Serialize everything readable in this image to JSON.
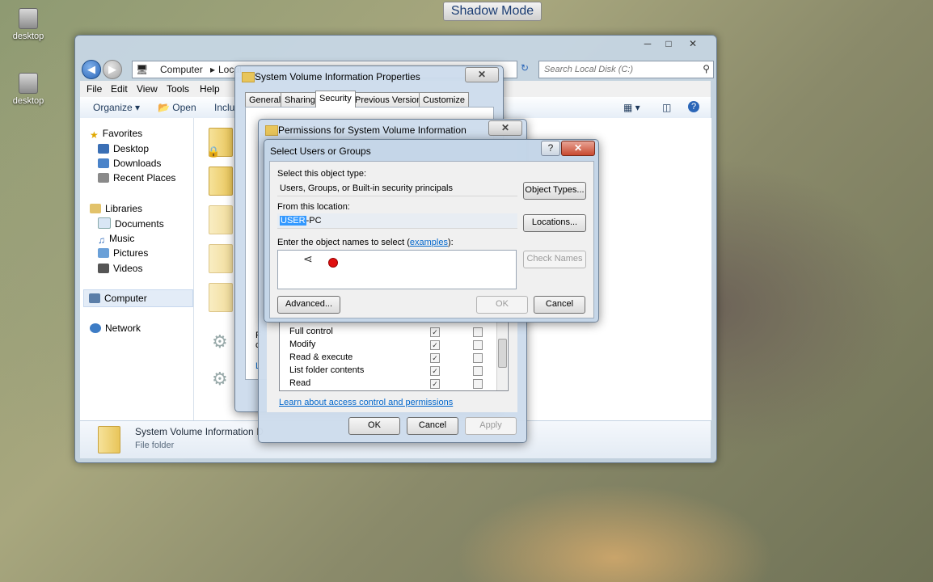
{
  "desktop": {
    "icons": [
      {
        "label": "desktop"
      },
      {
        "label": "desktop"
      }
    ]
  },
  "shadow_mode": {
    "label": "Shadow Mode"
  },
  "explorer": {
    "address": {
      "crumb1": "Computer",
      "crumb2": "Local"
    },
    "search_placeholder": "Search Local Disk (C:)",
    "menu": [
      "File",
      "Edit",
      "View",
      "Tools",
      "Help"
    ],
    "toolbar": {
      "organize": "Organize",
      "open": "Open",
      "include": "Inclu"
    },
    "nav": {
      "favorites": "Favorites",
      "desktop": "Desktop",
      "downloads": "Downloads",
      "recent": "Recent Places",
      "libraries": "Libraries",
      "documents": "Documents",
      "music": "Music",
      "pictures": "Pictures",
      "videos": "Videos",
      "computer": "Computer",
      "network": "Network"
    },
    "details": {
      "name": "System Volume Information",
      "name_tail": "D",
      "type": "File folder"
    }
  },
  "properties_dialog": {
    "title": "System Volume Information Properties",
    "tabs": [
      "General",
      "Sharing",
      "Security",
      "Previous Versions",
      "Customize"
    ],
    "frag_left1": "F",
    "frag_left2": "c",
    "frag_left3": "L"
  },
  "permissions_dialog": {
    "title": "Permissions for System Volume Information",
    "permissions": [
      {
        "label": "Full control",
        "allow": true,
        "deny": false
      },
      {
        "label": "Modify",
        "allow": true,
        "deny": false
      },
      {
        "label": "Read & execute",
        "allow": true,
        "deny": false
      },
      {
        "label": "List folder contents",
        "allow": true,
        "deny": false
      },
      {
        "label": "Read",
        "allow": true,
        "deny": false
      }
    ],
    "learn_link": "Learn about access control and permissions",
    "ok": "OK",
    "cancel": "Cancel",
    "apply": "Apply"
  },
  "select_dialog": {
    "title": "Select Users or Groups",
    "help": "?",
    "object_type_label": "Select this object type:",
    "object_type_value": "Users, Groups, or Built-in security principals",
    "object_types_btn": "Object Types...",
    "location_label": "From this location:",
    "location_selected": "USER",
    "location_rest": "-PC",
    "locations_btn": "Locations...",
    "names_label_prefix": "Enter the object names to select (",
    "names_link": "examples",
    "names_label_suffix": "):",
    "check_names_btn": "Check Names",
    "advanced_btn": "Advanced...",
    "ok_btn": "OK",
    "cancel_btn": "Cancel"
  }
}
